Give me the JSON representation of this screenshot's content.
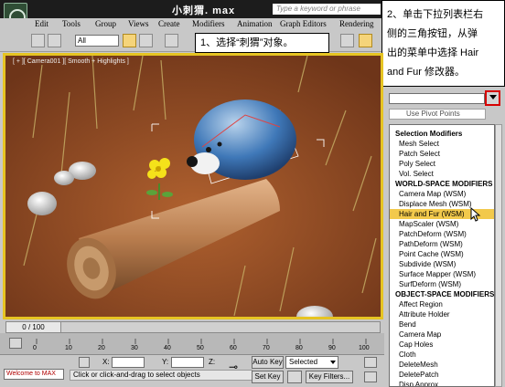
{
  "window": {
    "title": "小刺猬. max",
    "search_placeholder": "Type a keyword or phrase"
  },
  "menu": [
    "Edit",
    "Tools",
    "Group",
    "Views",
    "Create",
    "Modifiers",
    "Animation",
    "Graph Editors",
    "Rendering"
  ],
  "toolbar": {
    "filter_value": "All"
  },
  "callouts": {
    "step1": "1、选择“刺猬”对象。",
    "step2_lines": [
      "2、单击下拉列表栏右",
      "侧的三角按钮，从弹",
      "出的菜单中选择 Hair",
      "and Fur 修改器。"
    ]
  },
  "viewport": {
    "label": "[ + ][ Camera001 ][ Smooth + Highlights ]"
  },
  "modifier_panel": {
    "pivot_button": "Use Pivot Points",
    "list": [
      {
        "text": "Selection Modifiers",
        "kind": "header"
      },
      {
        "text": "Mesh Select",
        "kind": "item"
      },
      {
        "text": "Patch Select",
        "kind": "item"
      },
      {
        "text": "Poly Select",
        "kind": "item"
      },
      {
        "text": "Vol. Select",
        "kind": "item"
      },
      {
        "text": "WORLD-SPACE MODIFIERS",
        "kind": "header"
      },
      {
        "text": "Camera Map (WSM)",
        "kind": "item"
      },
      {
        "text": "Displace Mesh (WSM)",
        "kind": "item"
      },
      {
        "text": "Hair and Fur (WSM)",
        "kind": "selected"
      },
      {
        "text": "MapScaler (WSM)",
        "kind": "item"
      },
      {
        "text": "PatchDeform (WSM)",
        "kind": "item"
      },
      {
        "text": "PathDeform (WSM)",
        "kind": "item"
      },
      {
        "text": "Point Cache (WSM)",
        "kind": "item"
      },
      {
        "text": "Subdivide (WSM)",
        "kind": "item"
      },
      {
        "text": "Surface Mapper (WSM)",
        "kind": "item"
      },
      {
        "text": "SurfDeform (WSM)",
        "kind": "item"
      },
      {
        "text": "OBJECT-SPACE MODIFIERS",
        "kind": "header"
      },
      {
        "text": "Affect Region",
        "kind": "item"
      },
      {
        "text": "Attribute Holder",
        "kind": "item"
      },
      {
        "text": "Bend",
        "kind": "item"
      },
      {
        "text": "Camera Map",
        "kind": "item"
      },
      {
        "text": "Cap Holes",
        "kind": "item"
      },
      {
        "text": "Cloth",
        "kind": "item"
      },
      {
        "text": "DeleteMesh",
        "kind": "item"
      },
      {
        "text": "DeletePatch",
        "kind": "item"
      },
      {
        "text": "Disp Approx",
        "kind": "item"
      }
    ]
  },
  "timeline": {
    "frame_display": "0 / 100"
  },
  "track_ticks": [
    "0",
    "10",
    "20",
    "30",
    "40",
    "50",
    "60",
    "70",
    "80",
    "90",
    "100"
  ],
  "status": {
    "maxscript": "Welcome to MAX",
    "prompt": "Click or click-and-drag to select objects",
    "x_label": "X:",
    "y_label": "Y:",
    "z_label": "Z:",
    "auto_key": "Auto Key",
    "set_key": "Set Key",
    "selected_set": "Selected",
    "key_filters": "Key Filters..."
  },
  "colors": {
    "viewport_border": "#e6c423",
    "selected_modifier": "#f2c94c",
    "highlight_frame": "#d60000"
  }
}
